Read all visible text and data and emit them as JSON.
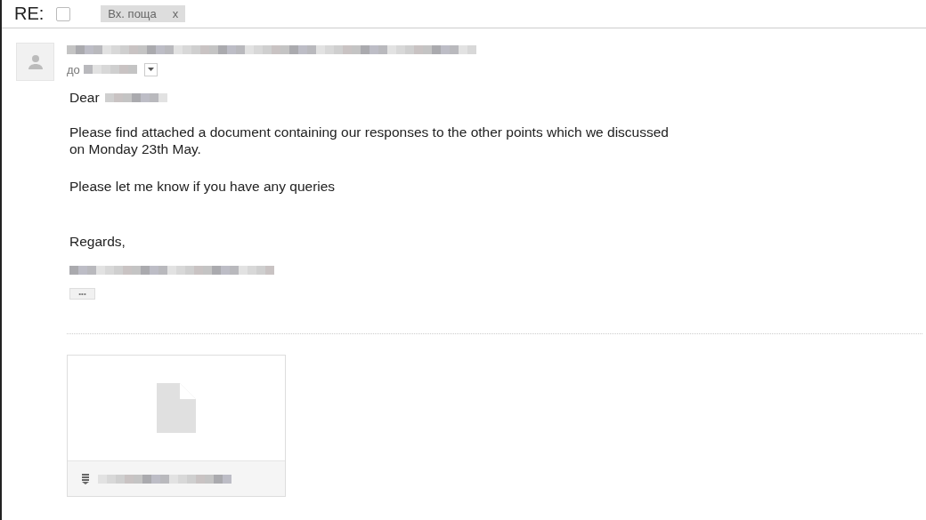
{
  "subject": "RE:",
  "labels": [
    {
      "text": "Вх. поща",
      "close": "x"
    }
  ],
  "message": {
    "to_prefix": "до",
    "greeting": "Dear",
    "paragraphs": [
      "Please find attached a document containing our responses to the other points which we discussed on Monday 23th May.",
      "Please let me know if you have any queries"
    ],
    "closing": "Regards,",
    "trimmed": "•••"
  }
}
